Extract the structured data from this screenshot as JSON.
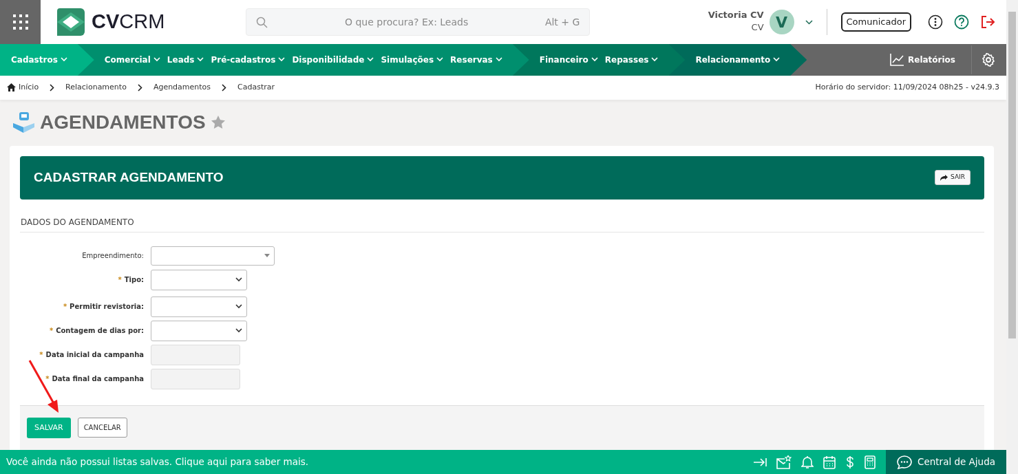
{
  "header": {
    "logo": "**CV**CRM",
    "search": {
      "placeholder": "O que procura? Ex: Leads",
      "shortcut": "Alt + G"
    },
    "user": {
      "name": "Victoria CV",
      "role": "CV",
      "avatar": "V"
    },
    "communicator": "Comunicador"
  },
  "nav": {
    "groups": [
      {
        "color": "#00b386",
        "items": [
          "Cadastros"
        ]
      },
      {
        "color": "#008f6e",
        "items": [
          "Comercial",
          "Leads",
          "Pré-cadastros",
          "Disponibilidade",
          "Simulações",
          "Reservas"
        ]
      },
      {
        "color": "#00775c",
        "items": [
          "Financeiro",
          "Repasses"
        ]
      },
      {
        "color": "#006b5a",
        "items": [
          "Relacionamento"
        ]
      }
    ],
    "reports": "Relatórios"
  },
  "breadcrumb": [
    "Início",
    "Relacionamento",
    "Agendamentos",
    "Cadastrar"
  ],
  "server_time": "Horário do servidor: 11/09/2024 08h25 - v24.9.3",
  "page_title": "AGENDAMENTOS",
  "form": {
    "title": "CADASTRAR AGENDAMENTO",
    "exit": "SAIR",
    "section": "DADOS DO AGENDAMENTO",
    "fields": [
      {
        "kind": "search-select",
        "label": "Empreendimento:",
        "required": false
      },
      {
        "kind": "select",
        "label": "Tipo:",
        "required": true,
        "marker": "*"
      },
      {
        "kind": "select",
        "label": "Permitir revistoria:",
        "required": true,
        "marker": "*"
      },
      {
        "kind": "select",
        "label": "Contagem de dias por:",
        "required": true,
        "marker": "*"
      },
      {
        "kind": "text",
        "label": "Data inicial da campanha",
        "required": true,
        "marker": "*",
        "disabled": true
      },
      {
        "kind": "text",
        "label": "Data final da campanha",
        "required": true,
        "marker": "*",
        "disabled": true
      }
    ],
    "buttons": [
      {
        "label": "SALVAR",
        "kind": "primary"
      },
      {
        "label": "CANCELAR",
        "kind": "secondary"
      }
    ]
  },
  "status_bar": {
    "message": "Você ainda não possui listas salvas. Clique aqui para saber mais.",
    "help": "Central de Ajuda"
  }
}
